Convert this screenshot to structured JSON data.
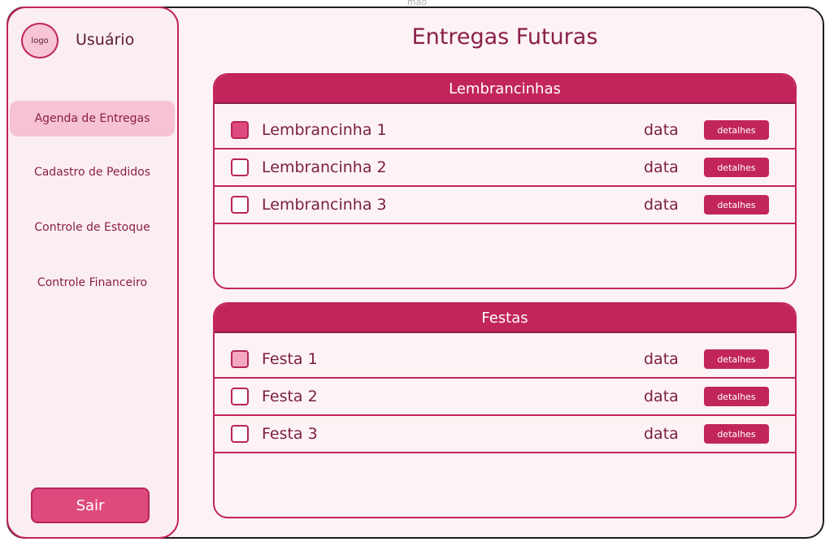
{
  "caption": "mão",
  "sidebar": {
    "logo": "logo",
    "user": "Usuário",
    "items": [
      {
        "label": "Agenda de Entregas",
        "active": true
      },
      {
        "label": "Cadastro de Pedidos",
        "active": false
      },
      {
        "label": "Controle de Estoque",
        "active": false
      },
      {
        "label": "Controle Financeiro",
        "active": false
      }
    ],
    "logout": "Sair"
  },
  "main": {
    "title": "Entregas Futuras",
    "sections": [
      {
        "title": "Lembrancinhas",
        "items": [
          {
            "label": "Lembrancinha 1",
            "date": "data",
            "action": "detalhes",
            "checked": "filled"
          },
          {
            "label": "Lembrancinha 2",
            "date": "data",
            "action": "detalhes",
            "checked": "empty"
          },
          {
            "label": "Lembrancinha 3",
            "date": "data",
            "action": "detalhes",
            "checked": "empty"
          }
        ]
      },
      {
        "title": "Festas",
        "items": [
          {
            "label": "Festa 1",
            "date": "data",
            "action": "detalhes",
            "checked": "partial"
          },
          {
            "label": "Festa 2",
            "date": "data",
            "action": "detalhes",
            "checked": "empty"
          },
          {
            "label": "Festa 3",
            "date": "data",
            "action": "detalhes",
            "checked": "empty"
          }
        ]
      }
    ]
  },
  "colors": {
    "accent": "#c2255c",
    "accent_light": "#f7c2d4",
    "background": "#fdf3f4"
  }
}
